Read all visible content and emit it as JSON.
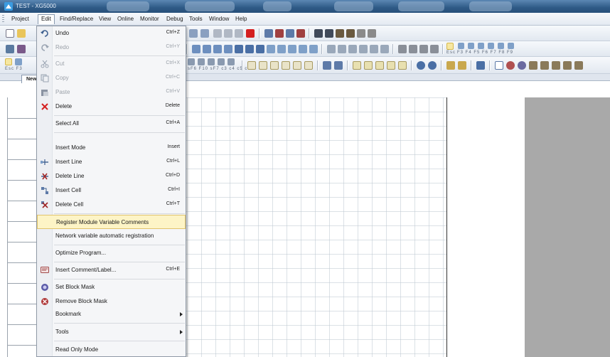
{
  "window": {
    "title": "TEST - XG5000"
  },
  "menubar": {
    "items": [
      {
        "label": "Project",
        "name": "menu-project"
      },
      {
        "label": "Edit",
        "name": "menu-edit"
      },
      {
        "label": "Find/Replace",
        "name": "menu-find-replace"
      },
      {
        "label": "View",
        "name": "menu-view"
      },
      {
        "label": "Online",
        "name": "menu-online"
      },
      {
        "label": "Monitor",
        "name": "menu-monitor"
      },
      {
        "label": "Debug",
        "name": "menu-debug"
      },
      {
        "label": "Tools",
        "name": "menu-tools"
      },
      {
        "label": "Window",
        "name": "menu-window"
      },
      {
        "label": "Help",
        "name": "menu-help"
      }
    ]
  },
  "toolbar": {
    "key_labels_row2": "F3  F4  F5  F6  F7  F8  F9",
    "esc_label": "Esc",
    "esc_f3_label": "Esc  F3",
    "key_labels_row3": "sF6 F10 sF7  c3   c4   c5   c6"
  },
  "tabs": {
    "active_label": "New"
  },
  "edit_menu": {
    "items": [
      {
        "label": "Undo",
        "shortcut": "Ctrl+Z",
        "icon": "undo-icon",
        "disabled": false
      },
      {
        "label": "Redo",
        "shortcut": "Ctrl+Y",
        "icon": "redo-icon",
        "disabled": true
      },
      {
        "label": "Cut",
        "shortcut": "Ctrl+X",
        "icon": "cut-icon",
        "disabled": true
      },
      {
        "label": "Copy",
        "shortcut": "Ctrl+C",
        "icon": "copy-icon",
        "disabled": true
      },
      {
        "label": "Paste",
        "shortcut": "Ctrl+V",
        "icon": "paste-icon",
        "disabled": true
      },
      {
        "label": "Delete",
        "shortcut": "Delete",
        "icon": "delete-icon",
        "disabled": false
      },
      {
        "label": "Select All",
        "shortcut": "Ctrl+A",
        "icon": "",
        "disabled": false
      },
      {
        "label": "Insert Mode",
        "shortcut": "Insert",
        "icon": "",
        "disabled": false
      },
      {
        "label": "Insert Line",
        "shortcut": "Ctrl+L",
        "icon": "insert-line-icon",
        "disabled": false
      },
      {
        "label": "Delete Line",
        "shortcut": "Ctrl+D",
        "icon": "delete-line-icon",
        "disabled": false
      },
      {
        "label": "Insert Cell",
        "shortcut": "Ctrl+I",
        "icon": "insert-cell-icon",
        "disabled": false
      },
      {
        "label": "Delete Cell",
        "shortcut": "Ctrl+T",
        "icon": "delete-cell-icon",
        "disabled": false
      },
      {
        "label": "Register Module Variable Comments",
        "shortcut": "",
        "icon": "",
        "disabled": false,
        "highlighted": true
      },
      {
        "label": "Network variable automatic registration",
        "shortcut": "",
        "icon": "",
        "disabled": false
      },
      {
        "label": "Optimize Program...",
        "shortcut": "",
        "icon": "",
        "disabled": false
      },
      {
        "label": "Insert Comment/Label...",
        "shortcut": "Ctrl+E",
        "icon": "comment-label-icon",
        "disabled": false
      },
      {
        "label": "Set Block Mask",
        "shortcut": "",
        "icon": "set-block-mask-icon",
        "disabled": false
      },
      {
        "label": "Remove Block Mask",
        "shortcut": "",
        "icon": "remove-block-mask-icon",
        "disabled": false
      },
      {
        "label": "Bookmark",
        "shortcut": "",
        "icon": "",
        "disabled": false,
        "submenu": true
      },
      {
        "label": "Tools",
        "shortcut": "",
        "icon": "",
        "disabled": false,
        "submenu": true
      },
      {
        "label": "Read Only Mode",
        "shortcut": "",
        "icon": "",
        "disabled": false
      }
    ]
  },
  "colors": {
    "titlebar": "#2f5a86",
    "menu_highlight": "#fdf4c6",
    "menu_highlight_border": "#e1c46c",
    "delete_red": "#d42020",
    "editor_side_panel": "#a9a9a9"
  }
}
